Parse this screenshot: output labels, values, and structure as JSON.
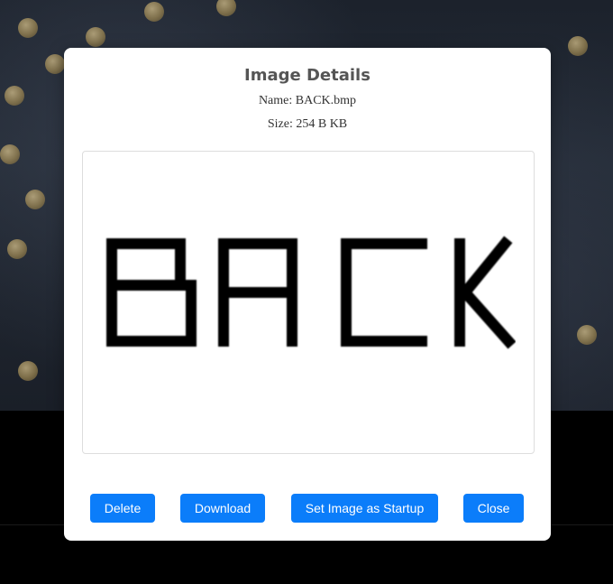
{
  "modal": {
    "title": "Image Details",
    "name_line": "Name: BACK.bmp",
    "size_line": "Size: 254 B KB",
    "preview_text": "BACK"
  },
  "buttons": {
    "delete": "Delete",
    "download": "Download",
    "set_startup": "Set Image as Startup",
    "close": "Close"
  },
  "colors": {
    "button_bg": "#0b7dfa",
    "title_color": "#555555"
  }
}
